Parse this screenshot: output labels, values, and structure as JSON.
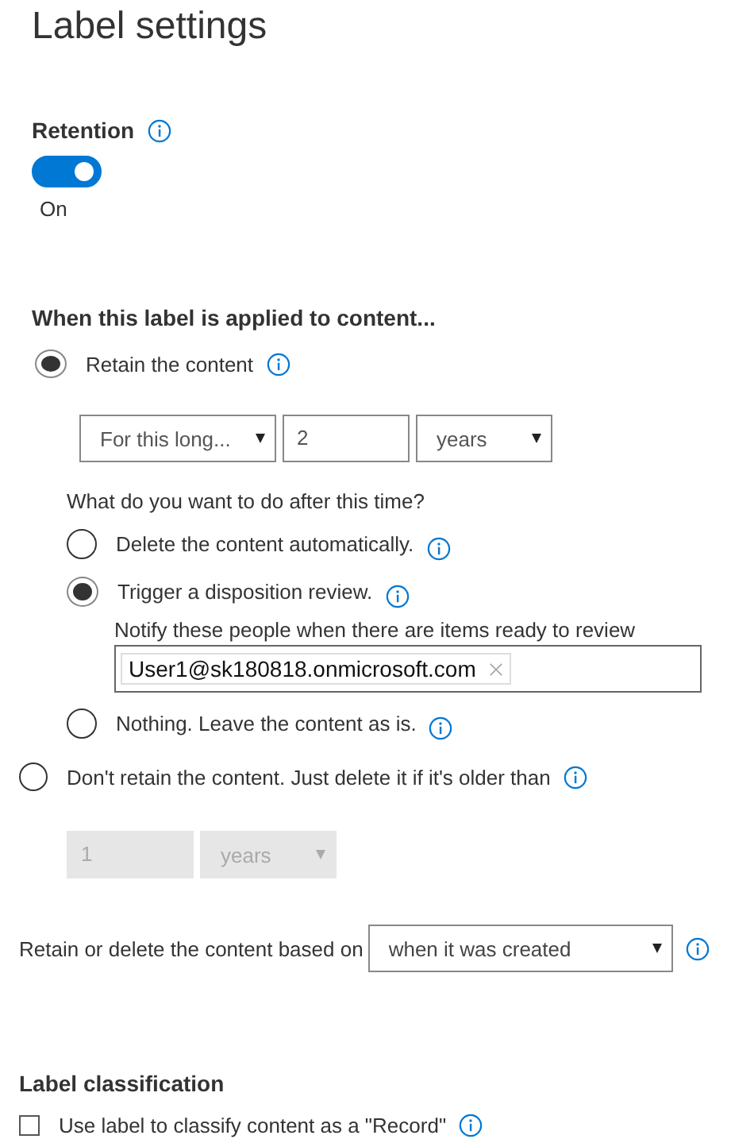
{
  "title": "Label settings",
  "retention": {
    "label": "Retention",
    "on": true,
    "state_text": "On"
  },
  "content": {
    "heading": "When this label is applied to content...",
    "options": [
      {
        "kind": "retain",
        "label": "Retain the content",
        "selected": true,
        "period": {
          "mode": "For this long...",
          "amount": "2",
          "unit": "years",
          "disabled": false
        },
        "question": "What do you want to do after this time?",
        "actions": [
          {
            "label": "Delete the content automatically.",
            "selected": false
          },
          {
            "label": "Trigger a disposition review.",
            "selected": true,
            "notify_label": "Notify these people when there are items ready to review",
            "recipients": [
              "User1@sk180818.onmicrosoft.com"
            ]
          },
          {
            "label": "Nothing. Leave the content as is.",
            "selected": false
          }
        ]
      },
      {
        "kind": "delete",
        "label": "Don't retain the content. Just delete it if it's older than",
        "selected": false,
        "period": {
          "amount": "1",
          "unit": "years",
          "disabled": true
        }
      }
    ]
  },
  "based_on": {
    "label": "Retain or delete the content based on",
    "value": "when it was created"
  },
  "classification": {
    "heading": "Label classification",
    "label": "Use label to classify content as a \"Record\"",
    "checked": false
  }
}
